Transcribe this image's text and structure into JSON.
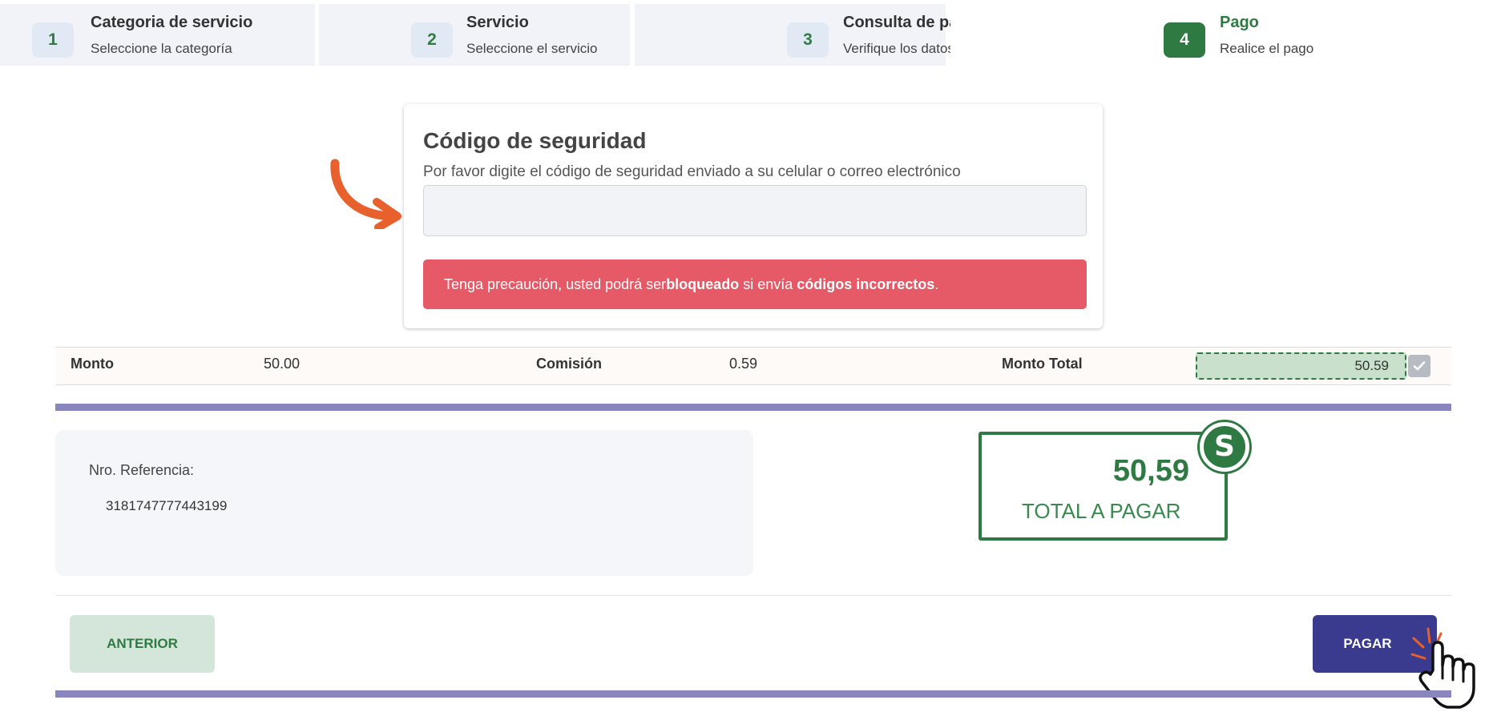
{
  "steps": [
    {
      "number": "1",
      "title": "Categoria de servicio",
      "subtitle": "Seleccione la categoría"
    },
    {
      "number": "2",
      "title": "Servicio",
      "subtitle": "Seleccione el servicio"
    },
    {
      "number": "3",
      "title": "Consulta de pago",
      "subtitle": "Verifique los datos"
    },
    {
      "number": "4",
      "title": "Pago",
      "subtitle": "Realice el pago"
    }
  ],
  "security": {
    "title": "Código de seguridad",
    "instruction": "Por favor digite el código de seguridad enviado a su celular o correo electrónico",
    "code_value": "",
    "warning": {
      "prefix": "Tenga precaución, usted podrá ser ",
      "bold1": "bloqueado",
      "middle": " si envía ",
      "bold2": "códigos incorrectos",
      "suffix": "."
    }
  },
  "totals": {
    "monto_label": "Monto",
    "monto_value": "50.00",
    "comision_label": "Comisión",
    "comision_value": "0.59",
    "total_label": "Monto Total",
    "total_value": "50.59"
  },
  "reference": {
    "label": "Nro. Referencia:",
    "value": "3181747777443199"
  },
  "summary": {
    "amount": "50,59",
    "label": "TOTAL A PAGAR",
    "badge_symbol": "S"
  },
  "buttons": {
    "previous": "ANTERIOR",
    "pay": "PAGAR"
  },
  "colors": {
    "brand_green": "#2f7a43",
    "warning_red": "#e55a66",
    "purple_bar": "#8985bd",
    "pay_button": "#3a3a8f",
    "annotation_orange": "#e8612c"
  },
  "icons": {
    "arrow": "curved-arrow-icon",
    "check": "check-icon",
    "dollar": "dollar-icon",
    "hand": "pointing-hand-icon"
  }
}
